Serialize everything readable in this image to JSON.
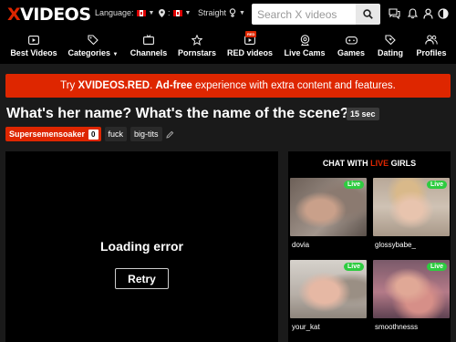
{
  "header": {
    "logo_x": "X",
    "logo_rest": "VIDEOS",
    "language_label": "Language:",
    "location_label": ":",
    "orientation_label": "Straight",
    "search_placeholder": "Search X videos"
  },
  "nav": {
    "items": [
      {
        "label": "Best Videos",
        "icon": "play-square-icon"
      },
      {
        "label": "Categories",
        "icon": "tag-icon"
      },
      {
        "label": "Channels",
        "icon": "tv-icon"
      },
      {
        "label": "Pornstars",
        "icon": "star-icon"
      },
      {
        "label": "RED videos",
        "icon": "red-play-icon",
        "badge": "RED"
      },
      {
        "label": "Live Cams",
        "icon": "cam-icon"
      },
      {
        "label": "Games",
        "icon": "gamepad-icon"
      },
      {
        "label": "Dating",
        "icon": "heart-tag-icon"
      },
      {
        "label": "Profiles",
        "icon": "users-icon"
      }
    ]
  },
  "banner": {
    "pre": "Try ",
    "brand": "XVIDEOS.RED",
    "mid": ". ",
    "bold": "Ad-free",
    "post": " experience with extra content and features."
  },
  "video": {
    "title": "What's her name? What's the name of the scene?",
    "duration": "15 sec",
    "uploader": "Supersemensoaker",
    "uploader_count": "0",
    "tags": [
      "fuck",
      "big-tits"
    ],
    "error_text": "Loading error",
    "retry_label": "Retry"
  },
  "live": {
    "title_pre": "CHAT WITH ",
    "title_hl": "LIVE",
    "title_post": " GIRLS",
    "badge": "Live",
    "cams": [
      {
        "name": "dovia"
      },
      {
        "name": "glossybabe_"
      },
      {
        "name": "your_kat"
      },
      {
        "name": "smoothnesss"
      }
    ]
  },
  "colors": {
    "brand_red": "#de2600",
    "live_green": "#2ecc40",
    "background": "#1a1a1a"
  }
}
